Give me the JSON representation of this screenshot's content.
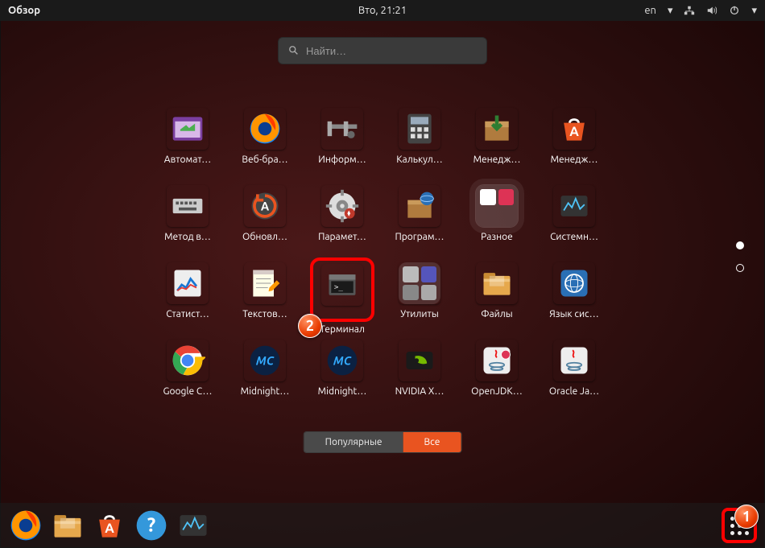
{
  "topbar": {
    "activities": "Обзор",
    "datetime": "Вто, 21:21",
    "lang": "en"
  },
  "search": {
    "placeholder": "Найти…"
  },
  "apps": [
    {
      "label": "Автомат…",
      "icon": "purple-window"
    },
    {
      "label": "Веб-бра…",
      "icon": "firefox"
    },
    {
      "label": "Информ…",
      "icon": "caliper"
    },
    {
      "label": "Калькул…",
      "icon": "calculator"
    },
    {
      "label": "Менедж…",
      "icon": "package-down"
    },
    {
      "label": "Менедж…",
      "icon": "software-center"
    },
    {
      "label": "Метод в…",
      "icon": "keyboard"
    },
    {
      "label": "Обновл…",
      "icon": "updater"
    },
    {
      "label": "Парамет…",
      "icon": "settings-gear"
    },
    {
      "label": "Програм…",
      "icon": "package-globe"
    },
    {
      "label": "Разное",
      "icon": "folder-misc",
      "selected": true
    },
    {
      "label": "Системн…",
      "icon": "system-monitor"
    },
    {
      "label": "Статист…",
      "icon": "stats"
    },
    {
      "label": "Текстов…",
      "icon": "text-editor"
    },
    {
      "label": "Терминал",
      "icon": "terminal",
      "framed": true
    },
    {
      "label": "Утилиты",
      "icon": "folder-utils"
    },
    {
      "label": "Файлы",
      "icon": "files"
    },
    {
      "label": "Язык сис…",
      "icon": "language"
    },
    {
      "label": "Google C…",
      "icon": "chrome"
    },
    {
      "label": "Midnight…",
      "icon": "mc"
    },
    {
      "label": "Midnight…",
      "icon": "mc"
    },
    {
      "label": "NVIDIA X…",
      "icon": "nvidia"
    },
    {
      "label": "OpenJDK…",
      "icon": "java-openjdk"
    },
    {
      "label": "Oracle Ja…",
      "icon": "java-oracle"
    }
  ],
  "toggle": {
    "popular": "Популярные",
    "all": "Все",
    "active": "all"
  },
  "pager": {
    "pages": 2,
    "active": 0
  },
  "dock": [
    {
      "name": "firefox"
    },
    {
      "name": "files"
    },
    {
      "name": "software-center"
    },
    {
      "name": "help"
    },
    {
      "name": "system-monitor"
    }
  ],
  "annotations": {
    "one": "1",
    "two": "2"
  }
}
